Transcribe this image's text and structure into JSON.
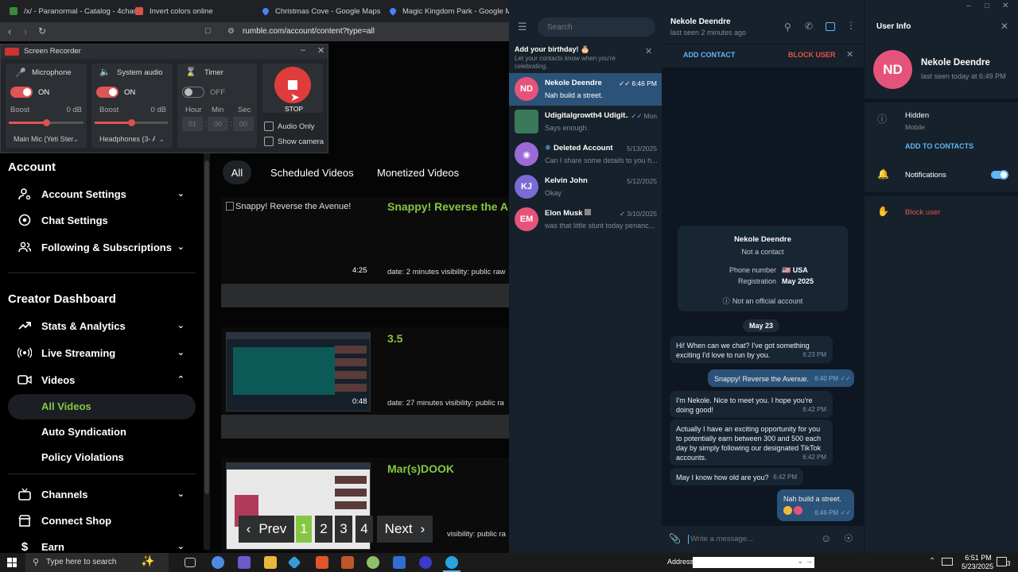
{
  "browser": {
    "tabs": [
      {
        "label": "/x/ - Paranormal - Catalog - 4chan"
      },
      {
        "label": "Invert colors online"
      },
      {
        "label": "Christmas Cove - Google Maps"
      },
      {
        "label": "Magic Kingdom Park - Google Map"
      }
    ],
    "url": "rumble.com/account/content?type=all"
  },
  "recorder": {
    "title": "Screen Recorder",
    "microphone": {
      "label": "Microphone",
      "state": "ON",
      "boost_label": "Boost",
      "boost_value": "0 dB",
      "device": "Main Mic (Yeti Ster"
    },
    "system_audio": {
      "label": "System audio",
      "state": "ON",
      "boost_label": "Boost",
      "boost_value": "0 dB",
      "device": "Headphones (3- A"
    },
    "timer": {
      "label": "Timer",
      "state": "OFF",
      "hour_label": "Hour",
      "min_label": "Min",
      "sec_label": "Sec",
      "hour": "01",
      "min": "00",
      "sec": "00"
    },
    "stop_label": "STOP",
    "audio_only_label": "Audio Only",
    "show_camera_label": "Show camera"
  },
  "sidebar": {
    "account_title": "Account",
    "account_items": [
      {
        "label": "Account Settings"
      },
      {
        "label": "Chat Settings"
      },
      {
        "label": "Following & Subscriptions"
      }
    ],
    "creator_title": "Creator Dashboard",
    "creator_items": [
      {
        "label": "Stats & Analytics"
      },
      {
        "label": "Live Streaming"
      },
      {
        "label": "Videos"
      }
    ],
    "video_subitems": [
      {
        "label": "All Videos"
      },
      {
        "label": "Auto Syndication"
      },
      {
        "label": "Policy Violations"
      }
    ],
    "bottom_items": [
      {
        "label": "Channels"
      },
      {
        "label": "Connect Shop"
      },
      {
        "label": "Earn"
      }
    ]
  },
  "content": {
    "tabs": [
      {
        "label": "All"
      },
      {
        "label": "Scheduled Videos"
      },
      {
        "label": "Monetized Videos"
      }
    ],
    "videos": [
      {
        "thumb_alt": "Snappy! Reverse the Avenue!",
        "title": "Snappy! Reverse the A",
        "duration": "4:25",
        "meta": "date: 2 minutes  visibility: public  raw"
      },
      {
        "title": "3.5",
        "duration": "0:48",
        "meta": "date: 27 minutes  visibility: public  ra"
      },
      {
        "title": "Mar(s)DOOK",
        "meta": "visibility: public  ra"
      }
    ],
    "pager": {
      "prev": "Prev",
      "next": "Next",
      "pages": [
        "1",
        "2",
        "3",
        "4"
      ],
      "current": "1"
    }
  },
  "telegram": {
    "search_placeholder": "Search",
    "birthday": {
      "title": "Add your birthday! 🎂",
      "subtitle": "Let your contacts know when you're celebrating."
    },
    "chats": [
      {
        "initials": "ND",
        "name": "Nekole Deendre",
        "preview": "Nah build a street.",
        "date": "6:46 PM",
        "color": "#e5537b"
      },
      {
        "initials": "",
        "name": "Udigitalgrowth4 Udigit...",
        "preview": "Says enough.",
        "date": "Mon",
        "color": "#3a7a5a"
      },
      {
        "initials": "",
        "name": "Deleted Account",
        "preview": "Can I share some details to you h...",
        "date": "5/13/2025",
        "color": "#9b6ad6"
      },
      {
        "initials": "KJ",
        "name": "Kelvin John",
        "preview": "Okay",
        "date": "5/12/2025",
        "color": "#7b6bd6"
      },
      {
        "initials": "EM",
        "name": "Elon Musk",
        "preview": "was that little stunt today penanc...",
        "date": "3/10/2025",
        "color": "#e5537b"
      }
    ],
    "chat": {
      "name": "Nekole Deendre",
      "status": "last seen 2 minutes ago",
      "add_contact": "ADD CONTACT",
      "block_user": "BLOCK USER",
      "card": {
        "name": "Nekole Deendre",
        "subtitle": "Not a contact",
        "phone_label": "Phone number",
        "phone_value": "🇺🇸 USA",
        "reg_label": "Registration",
        "reg_value": "May 2025",
        "official": "Not an official account"
      },
      "date_chip": "May 23",
      "messages": [
        {
          "dir": "in",
          "text": "Hi! When can we chat? I've got something exciting I'd love to run by you.",
          "time": "6:23 PM"
        },
        {
          "dir": "out",
          "text": "Snappy! Reverse the Avenue.",
          "time": "6:40 PM"
        },
        {
          "dir": "in",
          "text": "I'm Nekole. Nice to meet you. I hope you're doing good!",
          "time": "6:42 PM"
        },
        {
          "dir": "in",
          "text": "Actually I have an exciting opportunity for you to potentially earn between 300 and 500 each day by simply following our designated TikTok accounts.",
          "time": "6:42 PM"
        },
        {
          "dir": "in",
          "text": "May I know how old are you?",
          "time": "6:42 PM"
        },
        {
          "dir": "out",
          "text": "Nah build a street.",
          "time": "6:46 PM"
        }
      ],
      "composer_placeholder": "Write a message..."
    },
    "user_info": {
      "title": "User Info",
      "initials": "ND",
      "name": "Nekole Deendre",
      "status": "last seen today at 6:49 PM",
      "phone_value": "Hidden",
      "phone_label": "Mobile",
      "add_to_contacts": "ADD TO CONTACTS",
      "notifications": "Notifications",
      "notifications_on": true,
      "block": "Block user"
    }
  },
  "taskbar": {
    "search_placeholder": "Type here to search",
    "address_label": "Address",
    "time": "6:51 PM",
    "date": "5/23/2025",
    "notif_count": "3"
  },
  "colors": {
    "rumble_green": "#85c742",
    "telegram_blue": "#5eb5f7",
    "record_red": "#e03c3c",
    "block_red": "#e5534b"
  }
}
